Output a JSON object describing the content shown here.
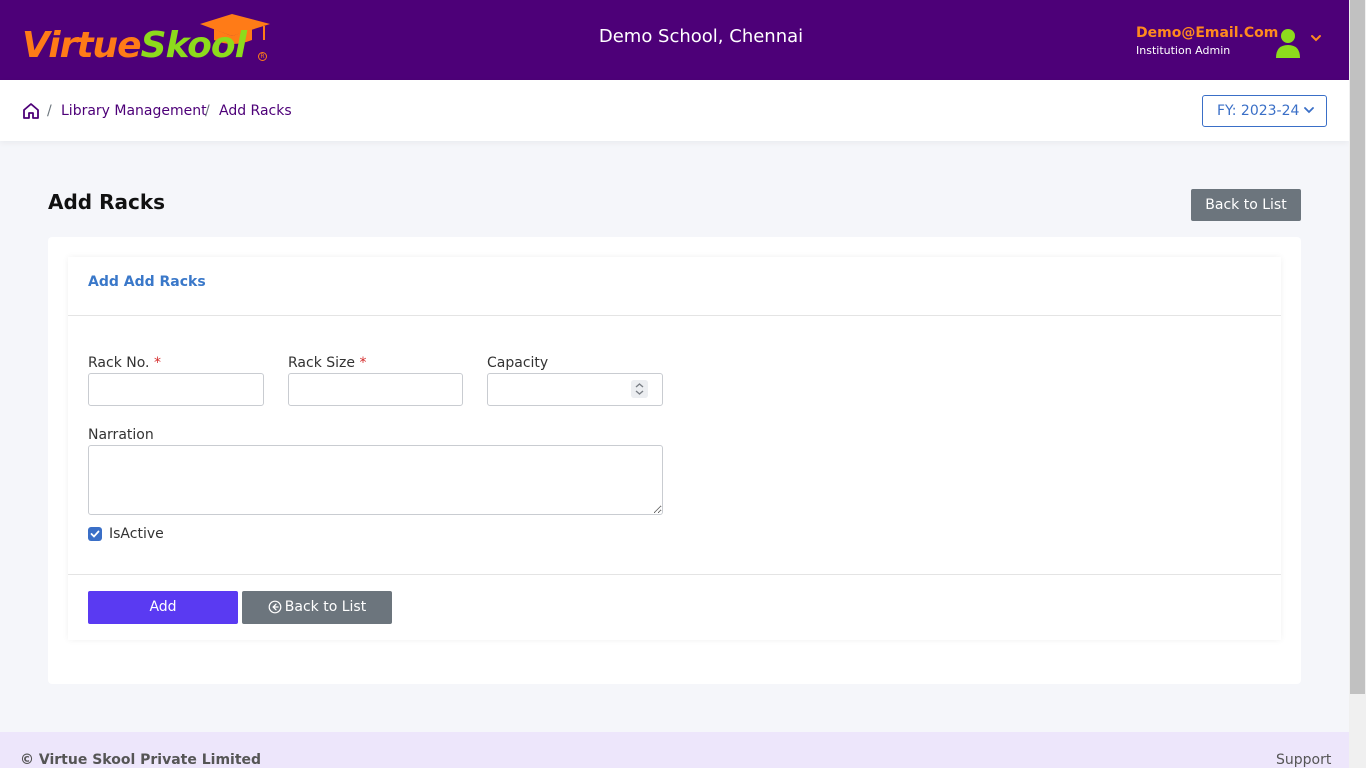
{
  "header": {
    "logo_part1": "Virtue",
    "logo_part2": "Skool",
    "logo_reg": "R",
    "school_name": "Demo School, Chennai",
    "user_email": "Demo@Email.Com",
    "user_role": "Institution Admin"
  },
  "breadcrumb": {
    "items": [
      "Library Management",
      "Add Racks"
    ],
    "separator": "/"
  },
  "fy_selector": {
    "label": "FY: 2023-24"
  },
  "page": {
    "title": "Add Racks",
    "top_back_label": "Back to List"
  },
  "form": {
    "card_title": "Add Add Racks",
    "rack_no": {
      "label": "Rack No.",
      "required_mark": "*",
      "value": ""
    },
    "rack_size": {
      "label": "Rack Size",
      "required_mark": "*",
      "value": ""
    },
    "capacity": {
      "label": "Capacity",
      "value": ""
    },
    "narration": {
      "label": "Narration",
      "value": ""
    },
    "is_active": {
      "label": "IsActive",
      "checked": true
    },
    "add_label": "Add",
    "back_label": "Back to List"
  },
  "footer": {
    "copyright": "© Virtue Skool Private Limited",
    "support": "Support"
  },
  "colors": {
    "header_bg": "#4d0078",
    "accent_orange": "#ff7b17",
    "accent_green": "#8ddb1c",
    "primary_button": "#5a3af2",
    "secondary_button": "#6c757d",
    "link_blue": "#3a78c9",
    "footer_bg": "#ede6fb"
  },
  "icons": {
    "logo_mark": "graduation-cap-icon",
    "avatar": "user-icon",
    "user_menu": "chevron-down-icon",
    "home": "home-icon",
    "fy_dropdown": "chevron-down-icon",
    "back": "circle-arrow-left-icon"
  }
}
